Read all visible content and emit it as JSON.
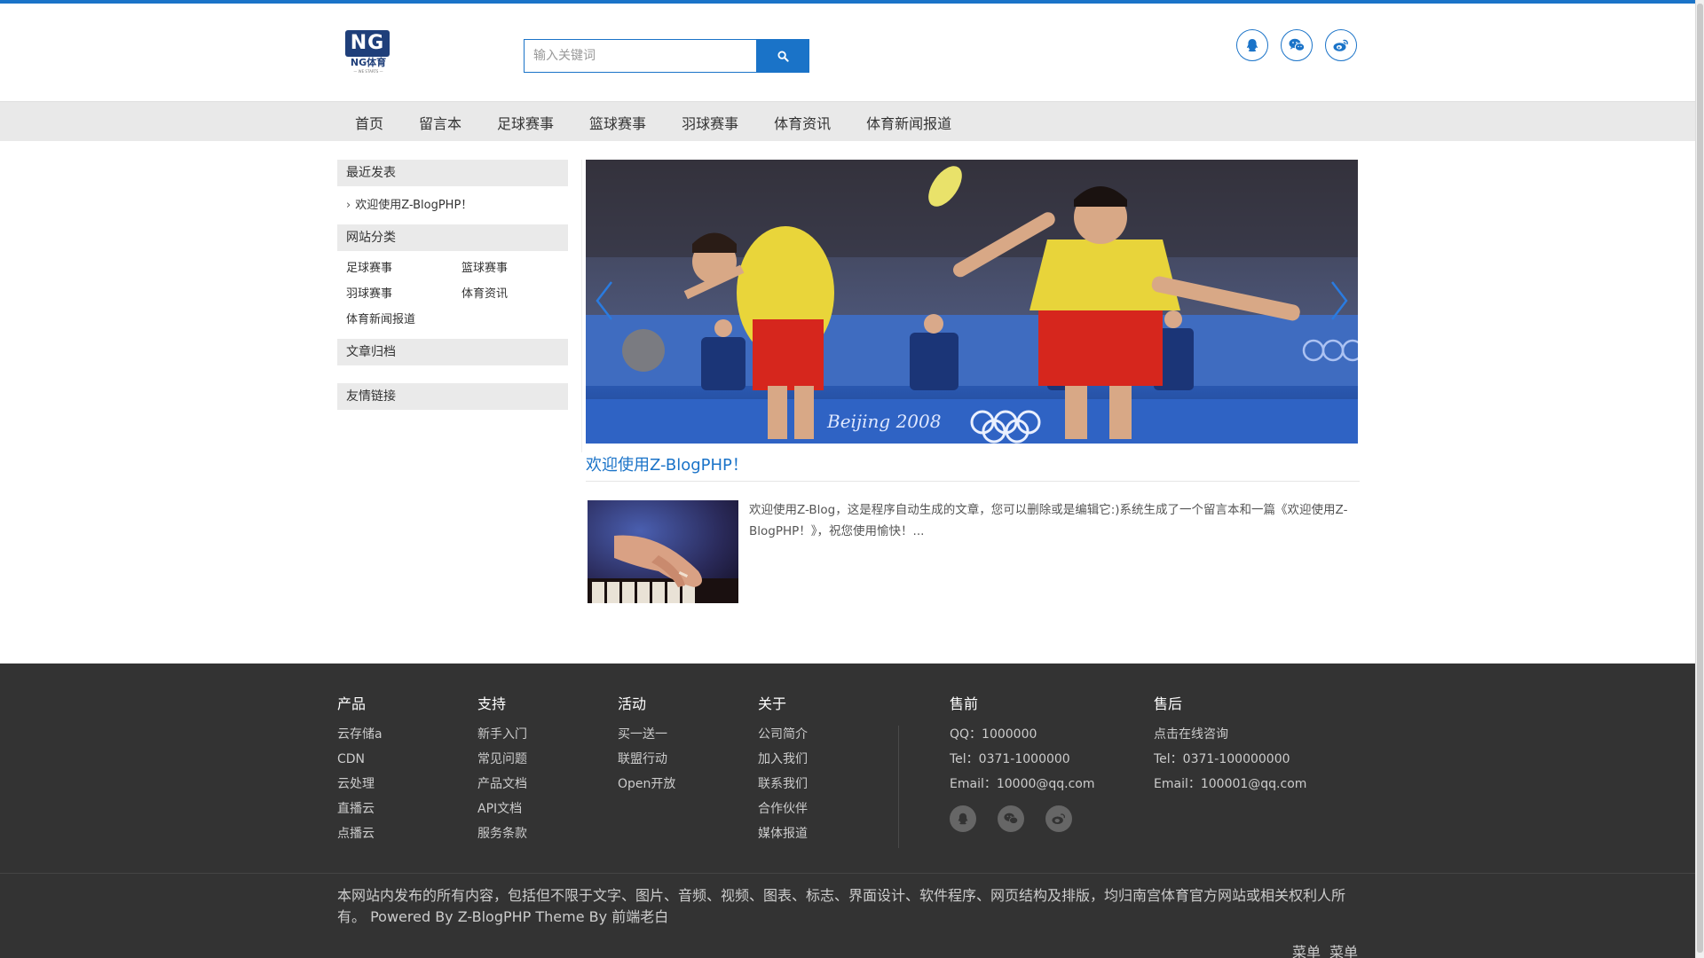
{
  "header": {
    "logo": {
      "mark": "NG",
      "text": "NG体育",
      "sub": "— WE STARTS —"
    },
    "search": {
      "placeholder": "输入关键词"
    },
    "social": [
      "qq-icon",
      "wechat-icon",
      "weibo-icon"
    ]
  },
  "nav": {
    "items": [
      "首页",
      "留言本",
      "足球赛事",
      "篮球赛事",
      "羽球赛事",
      "体育资讯",
      "体育新闻报道"
    ]
  },
  "sidebar": {
    "recent": {
      "title": "最近发表",
      "items": [
        "欢迎使用Z-BlogPHP！"
      ]
    },
    "categories": {
      "title": "网站分类",
      "items": [
        "足球赛事",
        "篮球赛事",
        "羽球赛事",
        "体育资讯",
        "体育新闻报道"
      ]
    },
    "archive": {
      "title": "文章归档"
    },
    "links": {
      "title": "友情链接"
    }
  },
  "main": {
    "slider_caption": "Beijing 2008",
    "post": {
      "title": "欢迎使用Z-BlogPHP！",
      "excerpt": "欢迎使用Z-Blog，这是程序自动生成的文章，您可以删除或是编辑它:)系统生成了一个留言本和一篇《欢迎使用Z-BlogPHP！》，祝您使用愉快！..."
    }
  },
  "footer": {
    "columns": [
      {
        "title": "产品",
        "links": [
          "云存储a",
          "CDN",
          "云处理",
          "直播云",
          "点播云"
        ]
      },
      {
        "title": "支持",
        "links": [
          "新手入门",
          "常见问题",
          "产品文档",
          "API文档",
          "服务条款"
        ]
      },
      {
        "title": "活动",
        "links": [
          "买一送一",
          "联盟行动",
          "Open开放"
        ]
      },
      {
        "title": "关于",
        "links": [
          "公司简介",
          "加入我们",
          "联系我们",
          "合作伙伴",
          "媒体报道"
        ]
      }
    ],
    "presale": {
      "title": "售前",
      "lines": [
        "QQ：1000000",
        "Tel：0371-1000000",
        "Email：10000@qq.com"
      ]
    },
    "aftersale": {
      "title": "售后",
      "lines": [
        "点击在线咨询",
        "Tel：0371-100000000",
        "Email：100001@qq.com"
      ]
    },
    "copyright": "本网站内发布的所有内容，包括但不限于文字、图片、音频、视频、图表、标志、界面设计、软件程序、网页结构及排版，均归南宫体育官方网站或相关权利人所有。 Powered By Z-BlogPHP Theme By 前端老白",
    "menu": [
      "菜单",
      "菜单"
    ]
  },
  "colors": {
    "accent": "#1a73c8",
    "footer_bg": "#333333",
    "nav_bg": "#e9e9e9"
  }
}
